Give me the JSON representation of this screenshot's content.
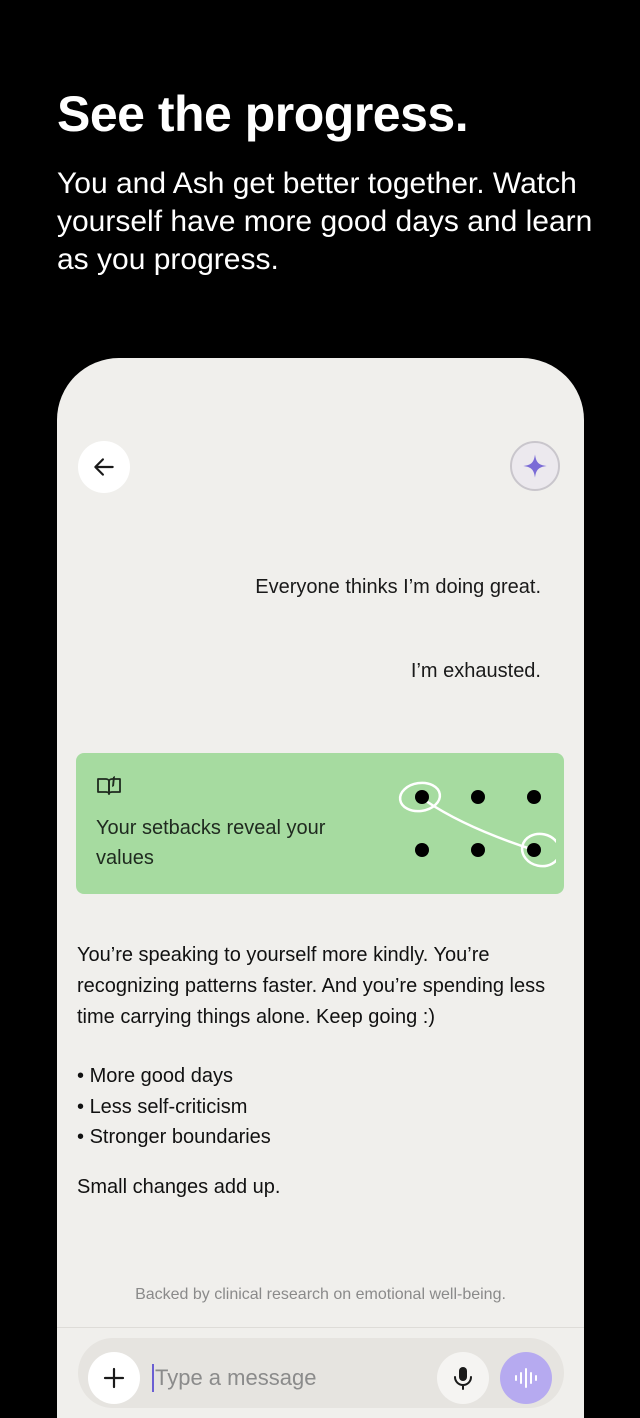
{
  "hero": {
    "title": "See the progress.",
    "subtitle": "You and Ash get better together. Watch yourself have more good days and learn as you progress."
  },
  "chat": {
    "user_messages": [
      "Everyone thinks I’m doing great.",
      "I’m exhausted."
    ],
    "insight_card": {
      "icon": "open-book-icon",
      "text": "Your setbacks reveal your values",
      "color": "#a6dba0"
    },
    "response": "You’re speaking to yourself more kindly. You’re recognizing patterns faster. And you’re spending less time carrying things alone. Keep going :)",
    "bullets": [
      "More good days",
      "Less self-criticism",
      "Stronger boundaries"
    ],
    "closing": "Small changes add up.",
    "footnote": "Backed by clinical research on emotional well-being."
  },
  "composer": {
    "placeholder": "Type a message",
    "accent": "#b6aaf0"
  },
  "icons": {
    "back": "arrow-left-icon",
    "assistant": "sparkle-icon",
    "add": "plus-icon",
    "mic": "microphone-icon",
    "voice": "waveform-icon"
  }
}
